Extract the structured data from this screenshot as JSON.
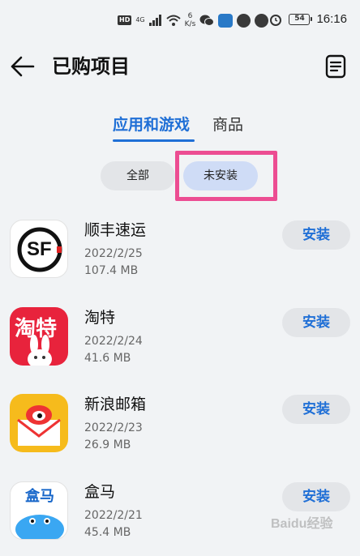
{
  "status_bar": {
    "hd": "HD",
    "signal": "4G",
    "speed_value": "6",
    "speed_unit": "K/s",
    "battery": "54",
    "time": "16:16"
  },
  "header": {
    "title": "已购项目"
  },
  "tabs": [
    {
      "label": "应用和游戏",
      "active": true
    },
    {
      "label": "商品",
      "active": false
    }
  ],
  "filters": [
    {
      "label": "全部",
      "selected": false
    },
    {
      "label": "未安装",
      "selected": true
    }
  ],
  "apps": [
    {
      "name": "顺丰速运",
      "date": "2022/2/25",
      "size": "107.4 MB",
      "action": "安装",
      "icon_text": "SF"
    },
    {
      "name": "淘特",
      "date": "2022/2/24",
      "size": "41.6 MB",
      "action": "安装",
      "icon_text": "淘特"
    },
    {
      "name": "新浪邮箱",
      "date": "2022/2/23",
      "size": "26.9 MB",
      "action": "安装",
      "icon_text": ""
    },
    {
      "name": "盒马",
      "date": "2022/2/21",
      "size": "45.4 MB",
      "action": "安装",
      "icon_text": "盒马"
    }
  ],
  "watermark": "Baidu经验",
  "colors": {
    "accent": "#1f6fd6",
    "highlight": "#ec4d92",
    "background": "#f1f3f5"
  }
}
